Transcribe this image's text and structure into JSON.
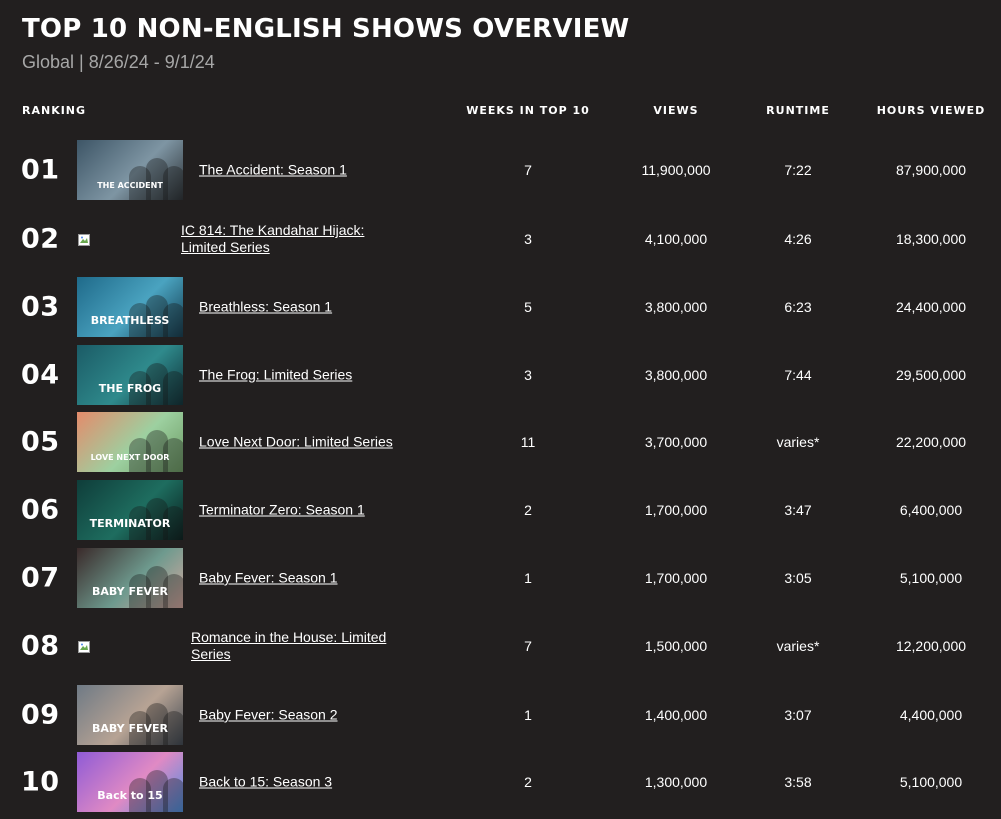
{
  "header": {
    "title": "TOP 10 NON-ENGLISH SHOWS OVERVIEW",
    "subtitle": "Global | 8/26/24 - 9/1/24"
  },
  "columns": {
    "ranking": "RANKING",
    "weeks": "WEEKS IN TOP 10",
    "views": "VIEWS",
    "runtime": "RUNTIME",
    "hours": "HOURS VIEWED"
  },
  "rows": [
    {
      "rank": "01",
      "title": "The Accident: Season 1",
      "weeks": "7",
      "views": "11,900,000",
      "runtime": "7:22",
      "hours": "87,900,000",
      "thumb_text": "THE ACCIDENT",
      "thumb_colors": [
        "#3d5566",
        "#7e95a3",
        "#2a2f33"
      ],
      "has_image": true
    },
    {
      "rank": "02",
      "title": "IC 814: The Kandahar Hijack: Limited Series",
      "weeks": "3",
      "views": "4,100,000",
      "runtime": "4:26",
      "hours": "18,300,000",
      "thumb_text": "",
      "thumb_colors": [],
      "has_image": false
    },
    {
      "rank": "03",
      "title": "Breathless: Season 1",
      "weeks": "5",
      "views": "3,800,000",
      "runtime": "6:23",
      "hours": "24,400,000",
      "thumb_text": "BREATHLESS",
      "thumb_colors": [
        "#1f6a8a",
        "#4aa3c0",
        "#123a4d"
      ],
      "has_image": true
    },
    {
      "rank": "04",
      "title": "The Frog: Limited Series",
      "weeks": "3",
      "views": "3,800,000",
      "runtime": "7:44",
      "hours": "29,500,000",
      "thumb_text": "THE FROG",
      "thumb_colors": [
        "#1b5b66",
        "#2f8a8c",
        "#0d2f36"
      ],
      "has_image": true
    },
    {
      "rank": "05",
      "title": "Love Next Door: Limited Series",
      "weeks": "11",
      "views": "3,700,000",
      "runtime": "varies*",
      "hours": "22,200,000",
      "thumb_text": "LOVE NEXT DOOR",
      "thumb_colors": [
        "#e48b6b",
        "#9dd0a0",
        "#6c9a63"
      ],
      "has_image": true
    },
    {
      "rank": "06",
      "title": "Terminator Zero: Season 1",
      "weeks": "2",
      "views": "1,700,000",
      "runtime": "3:47",
      "hours": "6,400,000",
      "thumb_text": "TERMINATOR",
      "thumb_colors": [
        "#0f3d3a",
        "#1e6d5f",
        "#081d1c"
      ],
      "has_image": true
    },
    {
      "rank": "07",
      "title": "Baby Fever: Season 1",
      "weeks": "1",
      "views": "1,700,000",
      "runtime": "3:05",
      "hours": "5,100,000",
      "thumb_text": "BABY FEVER",
      "thumb_colors": [
        "#3a2a2a",
        "#6e9a8e",
        "#d7a9a0"
      ],
      "has_image": true
    },
    {
      "rank": "08",
      "title": "Romance in the House: Limited Series",
      "weeks": "7",
      "views": "1,500,000",
      "runtime": "varies*",
      "hours": "12,200,000",
      "thumb_text": "",
      "thumb_colors": [],
      "has_image": false
    },
    {
      "rank": "09",
      "title": "Baby Fever: Season 2",
      "weeks": "1",
      "views": "1,400,000",
      "runtime": "3:07",
      "hours": "4,400,000",
      "thumb_text": "BABY FEVER",
      "thumb_colors": [
        "#6f7a85",
        "#b7a394",
        "#3e4650"
      ],
      "has_image": true
    },
    {
      "rank": "10",
      "title": "Back to 15: Season 3",
      "weeks": "2",
      "views": "1,300,000",
      "runtime": "3:58",
      "hours": "5,100,000",
      "thumb_text": "Back to 15",
      "thumb_colors": [
        "#8f5bd6",
        "#e08ac4",
        "#4b8fe0"
      ],
      "has_image": true
    }
  ]
}
